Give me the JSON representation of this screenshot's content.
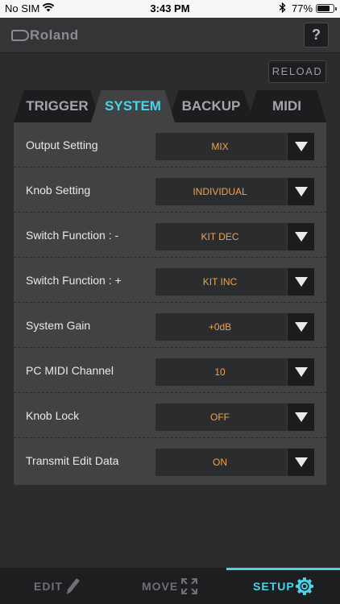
{
  "status_bar": {
    "carrier": "No SIM",
    "time": "3:43 PM",
    "battery_percent": "77%",
    "battery_level": 0.77
  },
  "header": {
    "logo_text": "Roland",
    "help_label": "?"
  },
  "reload_label": "RELOAD",
  "tabs": [
    {
      "label": "TRIGGER",
      "active": false
    },
    {
      "label": "SYSTEM",
      "active": true
    },
    {
      "label": "BACKUP",
      "active": false
    },
    {
      "label": "MIDI",
      "active": false
    }
  ],
  "settings": [
    {
      "label": "Output Setting",
      "value": "MIX"
    },
    {
      "label": "Knob Setting",
      "value": "INDIVIDUAL"
    },
    {
      "label": "Switch Function : -",
      "value": "KIT DEC"
    },
    {
      "label": "Switch Function : +",
      "value": "KIT INC"
    },
    {
      "label": "System Gain",
      "value": "+0dB"
    },
    {
      "label": "PC MIDI Channel",
      "value": "10"
    },
    {
      "label": "Knob Lock",
      "value": "OFF"
    },
    {
      "label": "Transmit Edit Data",
      "value": "ON"
    }
  ],
  "bottom_nav": [
    {
      "label": "EDIT",
      "icon": "pencil-icon",
      "active": false
    },
    {
      "label": "MOVE",
      "icon": "expand-arrows-icon",
      "active": false
    },
    {
      "label": "SETUP",
      "icon": "gear-icon",
      "active": true
    }
  ],
  "colors": {
    "accent": "#4cd3e6",
    "value_text": "#f0a24e",
    "panel": "#414244",
    "background": "#2b2c2e"
  }
}
